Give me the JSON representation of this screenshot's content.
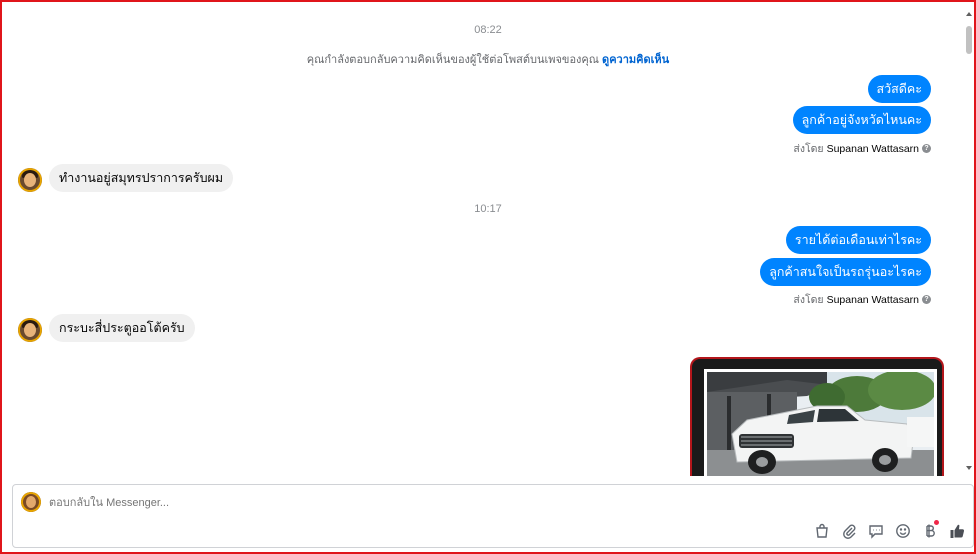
{
  "conversation": {
    "time_1": "08:22",
    "notice": {
      "text": "คุณกำลังตอบกลับความคิดเห็นของผู้ใช้ต่อโพสต์บนเพจของคุณ",
      "link": "ดูความคิดเห็น"
    },
    "out_1": "สวัสดีคะ",
    "out_2": "ลูกค้าอยู่จังหวัดไหนคะ",
    "sent_by_1": {
      "label": "ส่งโดย",
      "name": "Supanan Wattasarn"
    },
    "in_1": "ทำงานอยู่สมุทรปราการครับผม",
    "time_2": "10:17",
    "out_3": "รายได้ต่อเดือนเท่าไรคะ",
    "out_4": "ลูกค้าสนใจเป็นรถรุ่นอะไรคะ",
    "sent_by_2": {
      "label": "ส่งโดย",
      "name": "Supanan Wattasarn"
    },
    "in_2": "กระบะสี่ประตูออโต้ครับ"
  },
  "composer": {
    "placeholder": "ตอบกลับใน Messenger...",
    "tools": [
      "shop-icon",
      "attachment-icon",
      "saved-reply-icon",
      "emoji-icon",
      "payment-baht-icon",
      "thumbs-up-icon"
    ]
  },
  "colors": {
    "outgoing_bubble": "#0084ff",
    "incoming_bubble": "#f0f0f0",
    "link": "#0064d1",
    "frame": "#e0151b"
  }
}
